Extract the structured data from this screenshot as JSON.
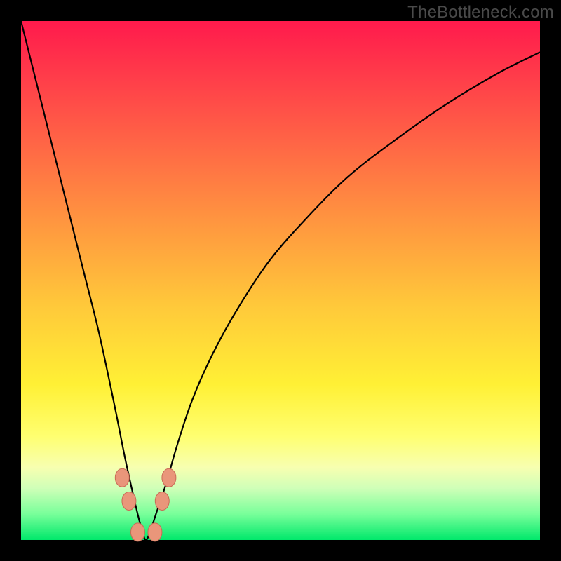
{
  "watermark": {
    "text": "TheBottleneck.com"
  },
  "colors": {
    "curve_stroke": "#000000",
    "marker_fill": "#e9967a",
    "marker_stroke": "#c96a55"
  },
  "chart_data": {
    "type": "line",
    "title": "",
    "xlabel": "",
    "ylabel": "",
    "ylim": [
      0,
      100
    ],
    "xlim": [
      0,
      100
    ],
    "description": "V-shaped bottleneck curve with minimum near x≈24; gradient background from red (top) to green (bottom); markers near the trough.",
    "x": [
      0,
      3,
      6,
      9,
      12,
      15,
      18,
      20,
      22,
      23,
      24,
      25,
      26,
      28,
      30,
      33,
      37,
      42,
      48,
      55,
      63,
      72,
      82,
      92,
      100
    ],
    "values": [
      100,
      88,
      76,
      64,
      52,
      40,
      26,
      16,
      7,
      3,
      0,
      2,
      5,
      11,
      18,
      27,
      36,
      45,
      54,
      62,
      70,
      77,
      84,
      90,
      94
    ],
    "markers": {
      "x": [
        19.5,
        20.8,
        27.2,
        28.5,
        22.5,
        25.8
      ],
      "y": [
        12,
        7.5,
        7.5,
        12,
        1.5,
        1.5
      ]
    }
  }
}
